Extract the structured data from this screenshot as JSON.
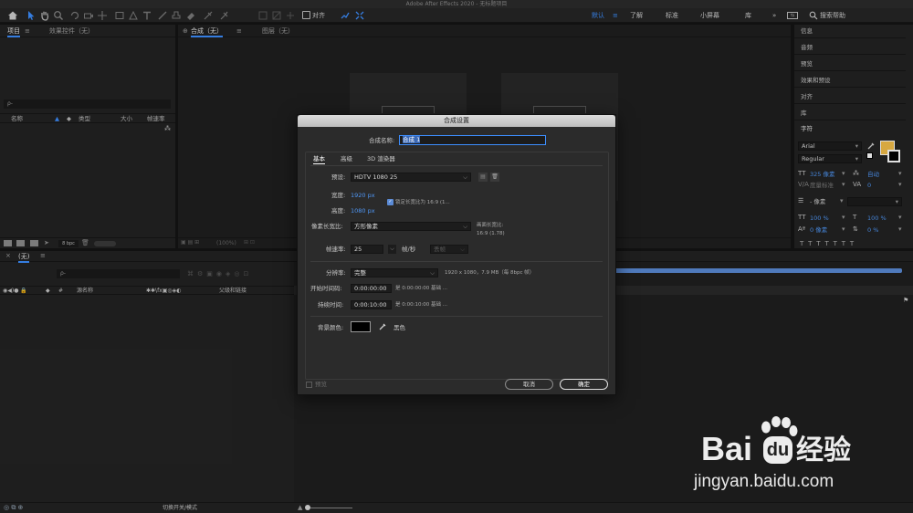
{
  "window": {
    "title": "Adobe After Effects 2020 - 无标题项目"
  },
  "toolbar": {
    "align_label": "对齐",
    "workspaces": [
      "默认",
      "了解",
      "标准",
      "小屏幕",
      "库"
    ],
    "active_workspace": "默认",
    "search_help_placeholder": "搜索帮助"
  },
  "project_panel": {
    "tab_project": "项目",
    "tab_effects": "效果控件（无）",
    "search_placeholder": "ρ‑",
    "columns": [
      "名称",
      "类型",
      "大小",
      "帧速率"
    ],
    "bpc": "8 bpc"
  },
  "comp_panel": {
    "tab_comp": "合成（无）",
    "tab_layer": "图层（无）",
    "zoom": "(100%)"
  },
  "timeline_panel": {
    "tab": "(无)",
    "search_placeholder": "ρ‑",
    "col_num": "#",
    "col_source": "源名称",
    "col_parent": "父级和链接",
    "toggle_label": "切换开关/模式"
  },
  "right_panel": {
    "items": [
      "信息",
      "音频",
      "预览",
      "效果和预设",
      "对齐",
      "库"
    ],
    "character_title": "字符",
    "font_family": "Arial",
    "font_style": "Regular",
    "font_size": "325 像素",
    "leading": "自动",
    "kerning": "度量标准",
    "tracking": "0",
    "stroke_width": "‑ 像素",
    "v_scale": "100 %",
    "h_scale": "100 %",
    "baseline": "0 像素",
    "tsume": "0 %",
    "fill_color": "#f5c04a"
  },
  "dialog": {
    "title": "合成设置",
    "name_label": "合成名称:",
    "name_value": "合成 1",
    "tabs": [
      "基本",
      "高级",
      "3D 渲染器"
    ],
    "preset_label": "预设:",
    "preset_value": "HDTV 1080 25",
    "width_label": "宽度:",
    "width_value": "1920 px",
    "height_label": "高度:",
    "height_value": "1080 px",
    "lock_label": "锁定长宽比为 16:9 (1...",
    "pixel_aspect_label": "像素长宽比:",
    "pixel_aspect_value": "方形像素",
    "frame_aspect_label": "画面长宽比:",
    "frame_aspect_value": "16:9 (1.78)",
    "fps_label": "帧速率:",
    "fps_value": "25",
    "fps_unit": "帧/秒",
    "drop_frame": "丢帧",
    "resolution_label": "分辨率:",
    "resolution_value": "完整",
    "resolution_info": "1920 x 1080，7.9 MB（每 8bpc 帧）",
    "start_tc_label": "开始时间码:",
    "start_tc_value": "0:00:00:00",
    "start_tc_note": "是 0:00:00:00  基础 ...",
    "duration_label": "持续时间:",
    "duration_value": "0:00:10:00",
    "duration_note": "是 0:00:10:00  基础 ...",
    "bg_label": "背景颜色:",
    "bg_color": "#000000",
    "bg_name": "黑色",
    "preview_label": "预览",
    "cancel_label": "取消",
    "ok_label": "确定"
  },
  "watermark": {
    "brand": "Bai",
    "brand2": "经验",
    "url": "jingyan.baidu.com"
  }
}
